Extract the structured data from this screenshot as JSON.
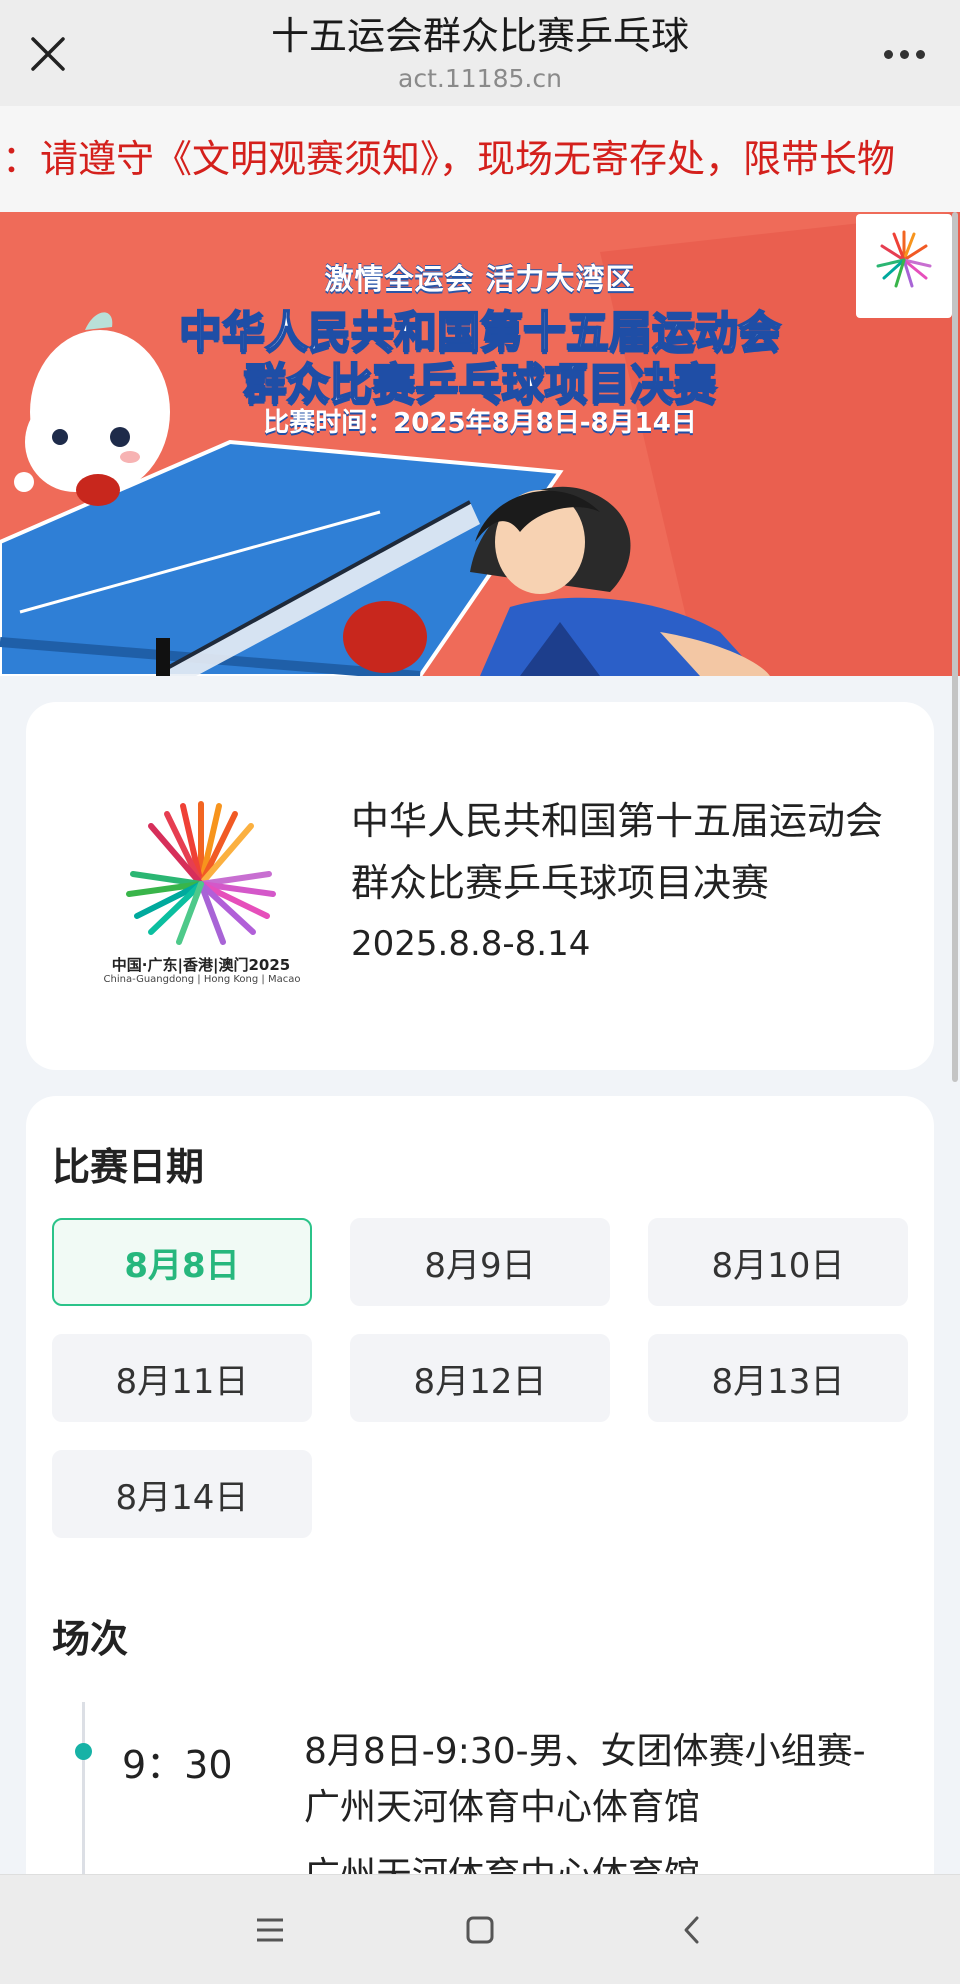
{
  "browser": {
    "title": "十五运会群众比赛乒乓球",
    "url": "act.11185.cn",
    "close_icon": "close-icon",
    "more_icon": "more-icon"
  },
  "notice": {
    "text": "示：请遵守《文明观赛须知》，现场无寄存处，限带长物"
  },
  "banner": {
    "slogan": "激情全运会 活力大湾区",
    "title_line1": "中华人民共和国第十五届运动会",
    "title_line2": "群众比赛乒乓球项目决赛",
    "date_line": "比赛时间：2025年8月8日-8月14日"
  },
  "event": {
    "title": "中华人民共和国第十五届运动会群众比赛乒乓球项目决赛",
    "date": "2025.8.8-8.14",
    "logo_caption": "中国·广东|香港|澳门2025",
    "logo_caption_en": "China-Guangdong | Hong Kong | Macao"
  },
  "schedule": {
    "dates_heading": "比赛日期",
    "dates": [
      "8月8日",
      "8月9日",
      "8月10日",
      "8月11日",
      "8月12日",
      "8月13日",
      "8月14日"
    ],
    "selected_date": "8月8日",
    "sessions_heading": "场次",
    "sessions": [
      {
        "time": "9：30",
        "description": "8月8日-9:30-男、女团体赛小组赛-广州天河体育中心体育馆"
      },
      {
        "time": "",
        "description": "广州天河体育中心体育馆"
      }
    ]
  },
  "colors": {
    "accent_green": "#27b77d",
    "notice_red": "#d4201c",
    "timeline_teal": "#17b2a6"
  },
  "system_nav": {
    "menu_icon": "menu-icon",
    "home_icon": "home-icon",
    "back_icon": "back-icon"
  }
}
